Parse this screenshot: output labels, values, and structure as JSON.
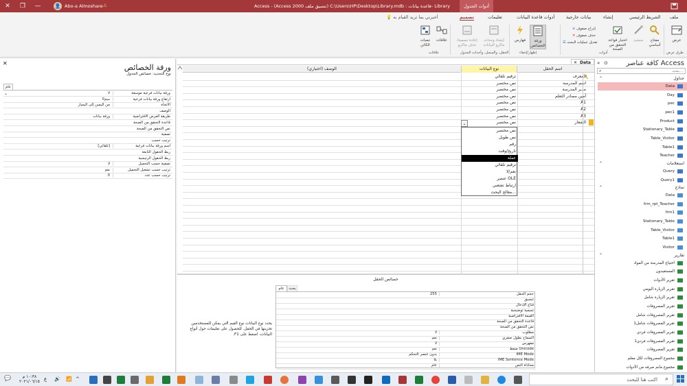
{
  "titlebar": {
    "contextual_tab": "أدوات الجدول",
    "title": "Access - (Access 2000 تنسيق ملف) C:\\Users\\HP\\Desktop\\Library.mdb : قاعدة بيانات- Library",
    "user": "Abo-a Almoshare",
    "warning": "⚠",
    "avatar": "👤"
  },
  "tabs": [
    "ملف",
    "الشريط الرئيسي",
    "إنشاء",
    "بيانات خارجية",
    "أدوات قاعدة البيانات",
    "تعليمات",
    "تصميم"
  ],
  "tell_me": "أخبرني بما تريد القيام به",
  "ribbon": {
    "view": "عرض",
    "primary_key": "مفتاح أساسي",
    "builder": "منشئ",
    "test_rules": "اختبار قواعد التحقق من الصحة",
    "insert_rows": "إدراج صفوف",
    "delete_rows": "حذف صفوف",
    "modify_lookups": "تعديل عمليات البحث",
    "property_sheet": "ورقة الخصائص",
    "indexes": "فهارس",
    "create_macros": "إنشاء وحدات ماكرو البيانات",
    "rename_macro": "إعادة تسمية/ حذف ماكرو",
    "relationships": "علاقات",
    "dependencies": "تبعيات الكائن",
    "groups": {
      "views": "طرق عرض",
      "tools": "أدوات",
      "show_hide": "إظهار/إخفاء",
      "events": "الحقل، والسجل، وأحداث الجدول",
      "relationships": "علاقات"
    }
  },
  "property_sheet": {
    "title": "ورقة الخصائص",
    "subtitle": "نوع التحديد: خصائص الجدول",
    "tab": "عام",
    "rows": [
      {
        "label": "ورقة بيانات فرعية موسعة",
        "value": "لا"
      },
      {
        "label": "ارتفاع ورقة بيانات فرعية",
        "value": "0سم"
      },
      {
        "label": "الاتجاه",
        "value": "من اليمين إلى اليسار"
      },
      {
        "label": "الوصف",
        "value": ""
      },
      {
        "label": "طريقة العرض الافتراضية",
        "value": "ورقة بيانات"
      },
      {
        "label": "قاعدة التحقق من الصحة",
        "value": ""
      },
      {
        "label": "نص التحقق من الصحة",
        "value": ""
      },
      {
        "label": "تصفية",
        "value": ""
      },
      {
        "label": "ترتيب حسب",
        "value": ""
      },
      {
        "label": "اسم ورقة بيانات فرعية",
        "value": "[تلقائي]"
      },
      {
        "label": "ربط الحقول التابعة",
        "value": ""
      },
      {
        "label": "ربط الحقول الرئيسية",
        "value": ""
      },
      {
        "label": "تصفية حسب التحميل",
        "value": "لا"
      },
      {
        "label": "ترتيب حسب تشغيل التحميل",
        "value": "نعم"
      },
      {
        "label": "ترتيب حسب عدد",
        "value": "0"
      }
    ]
  },
  "table_tab": "Data",
  "design": {
    "headers": {
      "field": "اسم الحقل",
      "type": "نوع البيانات",
      "desc": "(الوصف (اختياري"
    },
    "rows": [
      {
        "field": "المعرف",
        "type": "ترقيم تلقائي"
      },
      {
        "field": "اسم المدرسة",
        "type": "نص مختصر"
      },
      {
        "field": "مدير المدرسة",
        "type": "نص مختصر"
      },
      {
        "field": "أمين مصادر التعلم",
        "type": "نص مختصر"
      },
      {
        "field": "A1",
        "type": "نص مختصر"
      },
      {
        "field": "A2",
        "type": "نص مختصر"
      },
      {
        "field": "A3",
        "type": "نص مختصر"
      },
      {
        "field": "الشعار",
        "type": "نص مختصر"
      }
    ],
    "dropdown": [
      "نص مختصر",
      "نص طويل",
      "رقم",
      "تاريخ/وقت",
      "عملة",
      "ترقيم تلقائي",
      "نعم/لا",
      "عنصر OLE",
      "ارتباط تشعبي",
      "معالج البحث..."
    ]
  },
  "field_props": {
    "title": "خصائص الحقل",
    "tabs": [
      "عام",
      "بحث"
    ],
    "help": "يحدد نوع البيانات نوع القيم التي يمكن للمستخدمين تخزينها في الحقل. للحصول على تعليمات حول أنواع البيانات، اضغط على F1.",
    "rows": [
      {
        "label": "حجم الحقل",
        "value": "255"
      },
      {
        "label": "تنسيق",
        "value": ""
      },
      {
        "label": "قناع الإدخال",
        "value": ""
      },
      {
        "label": "تسمية توضيحية",
        "value": ""
      },
      {
        "label": "القيمة الافتراضية",
        "value": ""
      },
      {
        "label": "قاعدة التحقق من الصحة",
        "value": ""
      },
      {
        "label": "نص التحقق من الصحة",
        "value": ""
      },
      {
        "label": "مطلوب",
        "value": "لا"
      },
      {
        "label": "السماح بطول صفري",
        "value": "نعم"
      },
      {
        "label": "مفهرس",
        "value": "لا"
      },
      {
        "label": "ضغط Unicode",
        "value": "نعم"
      },
      {
        "label": "IME Mode",
        "value": "بدون عنصر التحكم"
      },
      {
        "label": "IME Sentence Mode",
        "value": "بلا"
      },
      {
        "label": "محاذاة النص",
        "value": "عام"
      }
    ]
  },
  "nav": {
    "title": "كافة عناصر Access",
    "search_placeholder": "بحث...",
    "groups": [
      {
        "name": "جداول",
        "items": [
          "Data",
          "Day",
          "pec",
          "pec1",
          "Product",
          "Stationary_Table",
          "Table_Visitor",
          "Table1",
          "Teacher"
        ]
      },
      {
        "name": "استعلامات",
        "items": [
          "Query",
          "Query1"
        ]
      },
      {
        "name": "نماذج",
        "items": [
          "Data",
          "frm_rpt_Teacher",
          "frm1",
          "Stationary_Table",
          "Table_Visitor",
          "Table1",
          "Visitor"
        ]
      },
      {
        "name": "تقارير",
        "items": [
          "احتياج المدرسة من المواد",
          "المستفيدون",
          "تقرير الأدوات",
          "تقرير الزيارة اليومي",
          "تقرير الزيارة شامل",
          "تقرير المصروفات",
          "تقرير المصروفات شامل",
          "تقرير المصروفات شامل1",
          "تقرير المصروفات فردي",
          "تقرير المصروفات فردي1",
          "تقرير المصروفات",
          "مجموع المصروفات لكل معلم",
          "مجموع مانم صرفه من الأدوات"
        ]
      }
    ]
  },
  "taskbar": {
    "search": "اكتب هنا للبحث",
    "time": "١٠:٣٨ م",
    "date": "٢٠٢١/٠٦/١٥",
    "lang": "ع"
  },
  "colors": {
    "accent": "#a4373a",
    "selection": "#f4b9bb",
    "field_header": "#fff4a8"
  }
}
